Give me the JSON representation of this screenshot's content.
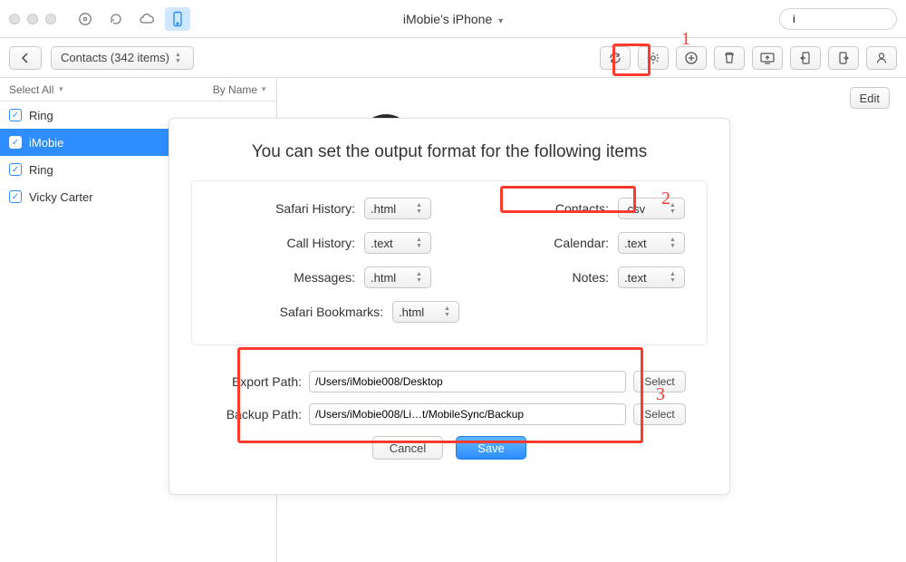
{
  "titlebar": {
    "device_name": "iMobie's iPhone",
    "search_value": "i"
  },
  "toolbar": {
    "breadcrumb": "Contacts (342 items)"
  },
  "sidebar": {
    "select_all": "Select All",
    "sort_label": "By Name",
    "items": [
      {
        "name": "Ring",
        "selected": false
      },
      {
        "name": "iMobie",
        "selected": true
      },
      {
        "name": "Ring",
        "selected": false
      },
      {
        "name": "Vicky Carter",
        "selected": false
      }
    ]
  },
  "main": {
    "edit_label": "Edit"
  },
  "dialog": {
    "title": "You can set the output format for the following items",
    "formats": {
      "safari_history": {
        "label": "Safari History:",
        "value": ".html"
      },
      "contacts": {
        "label": "Contacts:",
        "value": ".csv"
      },
      "call_history": {
        "label": "Call History:",
        "value": ".text"
      },
      "calendar": {
        "label": "Calendar:",
        "value": ".text"
      },
      "messages": {
        "label": "Messages:",
        "value": ".html"
      },
      "notes": {
        "label": "Notes:",
        "value": ".text"
      },
      "safari_bookmarks": {
        "label": "Safari Bookmarks:",
        "value": ".html"
      }
    },
    "export_path_label": "Export Path:",
    "export_path": "/Users/iMobie008/Desktop",
    "backup_path_label": "Backup Path:",
    "backup_path": "/Users/iMobie008/Li…t/MobileSync/Backup",
    "select_label": "Select",
    "cancel_label": "Cancel",
    "save_label": "Save"
  },
  "annotations": {
    "n1": "1",
    "n2": "2",
    "n3": "3"
  }
}
